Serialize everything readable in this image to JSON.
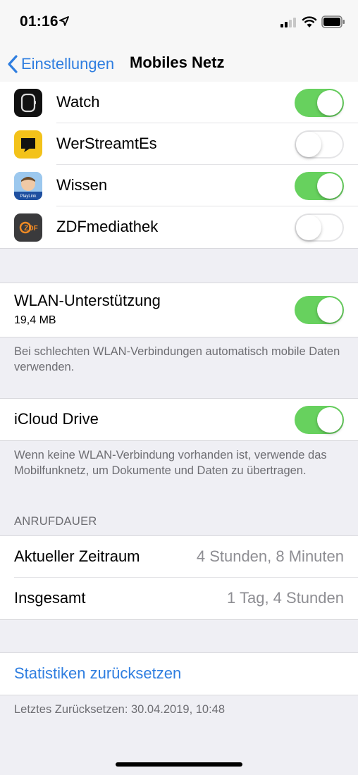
{
  "status": {
    "time": "01:16"
  },
  "nav": {
    "back_label": "Einstellungen",
    "title": "Mobiles Netz"
  },
  "apps": [
    {
      "name": "Watch",
      "icon": "watch-app-icon",
      "enabled": true
    },
    {
      "name": "WerStreamtEs",
      "icon": "werstreamtes-app-icon",
      "enabled": false
    },
    {
      "name": "Wissen",
      "icon": "wissen-app-icon",
      "icon_text": "PlayLink",
      "enabled": true
    },
    {
      "name": "ZDFmediathek",
      "icon": "zdf-app-icon",
      "icon_text": "ZDF",
      "enabled": false
    }
  ],
  "wlan": {
    "label": "WLAN-Unterstützung",
    "size": "19,4 MB",
    "enabled": true,
    "footer": "Bei schlechten WLAN-Verbindungen automatisch mobile Daten verwenden."
  },
  "icloud": {
    "label": "iCloud Drive",
    "enabled": true,
    "footer": "Wenn keine WLAN-Verbindung vorhanden ist, verwende das Mobilfunknetz, um Dokumente und Daten zu übertragen."
  },
  "call_duration": {
    "header": "ANRUFDAUER",
    "rows": [
      {
        "label": "Aktueller Zeitraum",
        "value": "4 Stunden, 8 Minuten"
      },
      {
        "label": "Insgesamt",
        "value": "1 Tag, 4 Stunden"
      }
    ]
  },
  "reset": {
    "label": "Statistiken zurücksetzen",
    "footer": "Letztes Zurücksetzen: 30.04.2019, 10:48"
  },
  "colors": {
    "accent": "#2f7ee0",
    "toggle_on": "#67d15e"
  }
}
